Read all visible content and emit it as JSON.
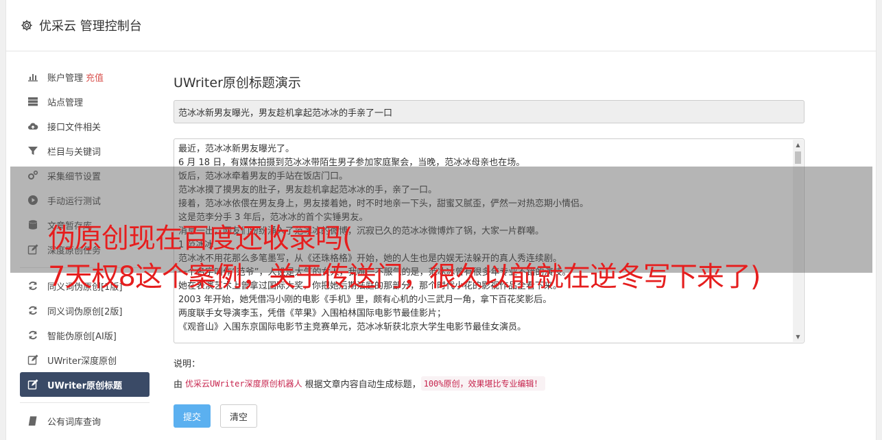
{
  "header": {
    "title": "优采云 管理控制台"
  },
  "sidebar": {
    "group1": [
      {
        "icon": "bar-chart-icon",
        "label": "账户管理",
        "extra": "充值"
      },
      {
        "icon": "server-icon",
        "label": "站点管理"
      },
      {
        "icon": "cloud-upload-icon",
        "label": "接口文件相关"
      },
      {
        "icon": "filter-icon",
        "label": "栏目与关键词"
      },
      {
        "icon": "cogs-icon",
        "label": "采集细节设置"
      },
      {
        "icon": "play-circle-icon",
        "label": "手动运行测试"
      },
      {
        "icon": "database-icon",
        "label": "文章暂存库"
      },
      {
        "icon": "edit-icon",
        "label": "深度原创任务"
      }
    ],
    "group2": [
      {
        "icon": "refresh-icon",
        "label": "同义词伪原创[1版]"
      },
      {
        "icon": "refresh-icon",
        "label": "同义词伪原创[2版]"
      },
      {
        "icon": "refresh-icon",
        "label": "智能伪原创[AI版]"
      },
      {
        "icon": "edit-icon",
        "label": "UWriter深度原创"
      },
      {
        "icon": "edit-icon",
        "label": "UWriter原创标题",
        "active": true
      }
    ],
    "group3": [
      {
        "icon": "book-icon",
        "label": "公有词库查询"
      }
    ]
  },
  "main": {
    "heading": "UWriter原创标题演示",
    "title_value": "范冰冰新男友曝光，男友趁机拿起范冰冰的手亲了一口",
    "article_lines": [
      "最近，范冰冰新男友曝光了。",
      "6 月 18 日，有媒体拍摄到范冰冰带陌生男子参加家庭聚会，当晚，范冰冰母亲也在场。",
      "饭后，范冰冰牵着男友的手站在饭店门口。",
      "范冰冰摸了摸男友的肚子，男友趁机拿起范冰冰的手，亲了一口。",
      "接着，范冰冰依偎在男友身上，男友搂着她，时不时地亲一下头，甜蜜又腻歪，俨然一对热恋期小情侣。",
      "这是范李分手 3 年后，范冰冰的首个实锤男友。",
      "消息一出，网友们纷纷涌入了范冰冰的微博，沉寂已久的范冰冰微博炸了锅，大家一片群嘲。",
      "1 范冰冰",
      "范冰冰不用花那么多笔墨写，从《还珠格格》开始，她的人生也是内娱无法躲开的真人秀连续剧。",
      "一个名字叫作“范爷”，人设是大气的女人，我唯一不服气的是，范冰冰曾有很多年专业不错的演技。",
      "她在表演艺术上曾拿过国际大奖，你把她后期法庭的那部分，那个时代小花的影视作品全看下来。",
      "2003 年开始，她凭借冯小刚的电影《手机》里，颇有心机的小三武月一角，拿下百花奖影后。",
      "两度联手女导演李玉，凭借《苹果》入围柏林国际电影节最佳影片；",
      "《观音山》入围东京国际电影节主竞赛单元，范冰冰斩获北京大学生电影节最佳女演员。"
    ],
    "note_label": "说明：",
    "note_prefix": "由",
    "note_robot": "优采云UWriter深度原创机器人",
    "note_middle": "根据文章内容自动生成标题，",
    "note_highlight": "100%原创，效果堪比专业编辑！",
    "submit_label": "提交",
    "clear_label": "清空"
  },
  "watermark": {
    "line1": "伪原创现在百度还收录吗(",
    "line2": "7天权8这个案例，关于传送门，很久以前就在逆冬写下来了)"
  }
}
